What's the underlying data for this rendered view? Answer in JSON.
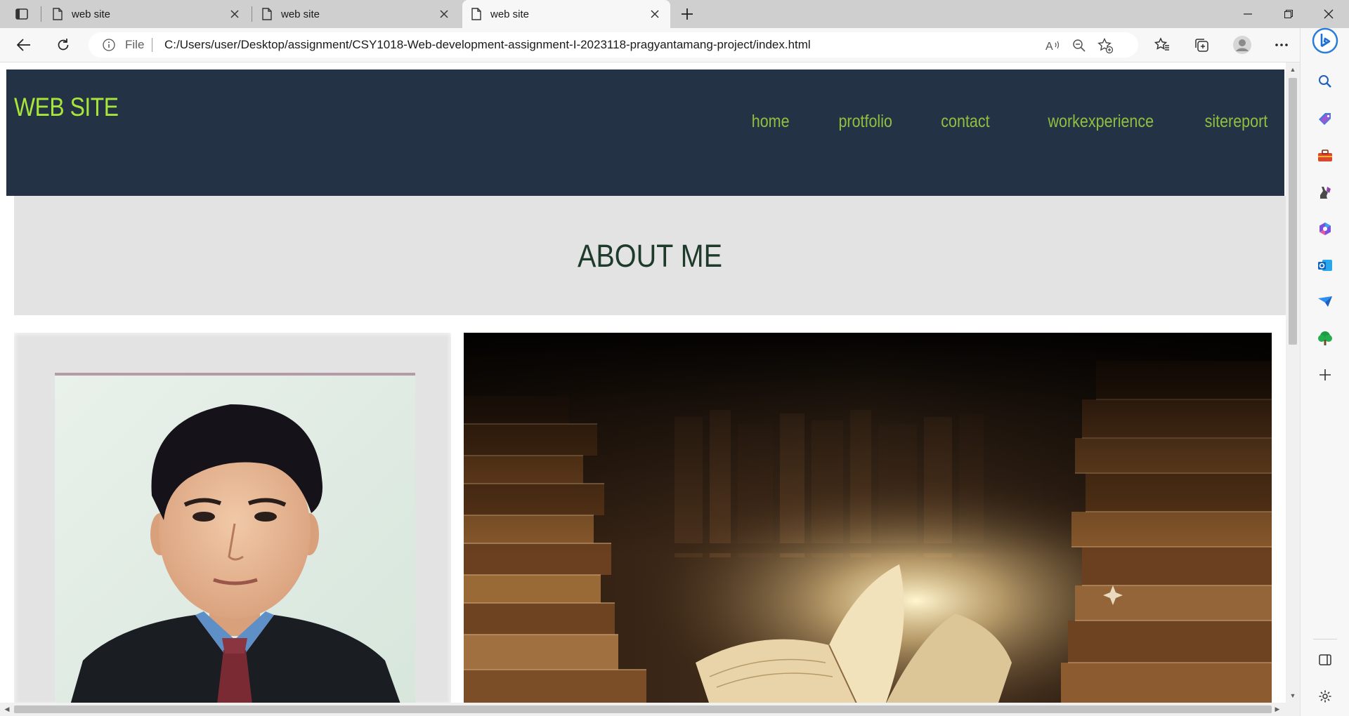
{
  "browser": {
    "tabs": [
      {
        "title": "web site",
        "active": false
      },
      {
        "title": "web site",
        "active": false
      },
      {
        "title": "web site",
        "active": true
      }
    ],
    "address": {
      "scheme_label": "File",
      "url": "C:/Users/user/Desktop/assignment/CSY1018-Web-development-assignment-I-2023118-pragyantamang-project/index.html"
    },
    "toolbar_icons": [
      "back-icon",
      "refresh-icon",
      "read-aloud-icon",
      "zoom-out-icon",
      "add-favorite-icon",
      "favorites-icon",
      "collections-icon",
      "profile-icon",
      "more-icon",
      "bing-copilot-icon"
    ],
    "sidebar_icons": [
      "search-icon",
      "shopping-tag-icon",
      "tools-icon",
      "games-icon",
      "microsoft365-icon",
      "outlook-icon",
      "drop-icon",
      "tree-icon",
      "add-icon",
      "split-screen-icon",
      "settings-icon"
    ]
  },
  "page": {
    "brand": "WEB SITE",
    "nav": [
      {
        "label": "home"
      },
      {
        "label": "protfolio"
      },
      {
        "label": "contact"
      },
      {
        "label": "workexperience"
      },
      {
        "label": "sitereport"
      }
    ],
    "section_title": "ABOUT ME"
  },
  "colors": {
    "header_bg": "#243246",
    "brand": "#a8e63a",
    "nav": "#8fbf3f",
    "section_bg": "#e3e3e3",
    "section_title": "#1e3a2a"
  }
}
